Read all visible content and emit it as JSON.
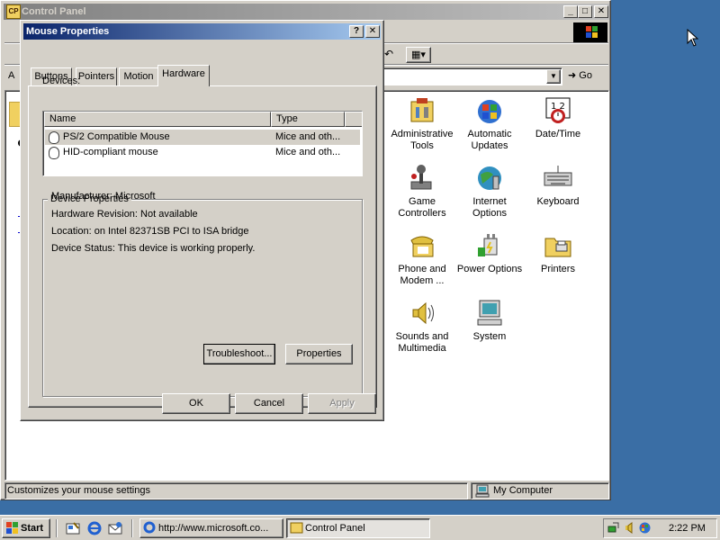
{
  "control_panel": {
    "title": "Control Panel",
    "go_label": "Go",
    "address_letter": "A",
    "status_text": "Customizes your mouse settings",
    "status_zone": "My Computer",
    "items": [
      {
        "label": "Administrative Tools",
        "icon": "admin-tools-icon"
      },
      {
        "label": "Automatic Updates",
        "icon": "windows-update-icon"
      },
      {
        "label": "Date/Time",
        "icon": "calendar-clock-icon"
      },
      {
        "label": "Game Controllers",
        "icon": "joystick-icon"
      },
      {
        "label": "Internet Options",
        "icon": "globe-icon"
      },
      {
        "label": "Keyboard",
        "icon": "keyboard-icon"
      },
      {
        "label": "Phone and Modem ...",
        "icon": "phone-icon"
      },
      {
        "label": "Power Options",
        "icon": "power-plug-icon"
      },
      {
        "label": "Printers",
        "icon": "printer-folder-icon"
      },
      {
        "label": "Sounds and Multimedia",
        "icon": "speaker-icon"
      },
      {
        "label": "System",
        "icon": "computer-icon"
      }
    ]
  },
  "dialog": {
    "title": "Mouse Properties",
    "help_glyph": "?",
    "close_glyph": "✕",
    "tabs": [
      "Buttons",
      "Pointers",
      "Motion",
      "Hardware"
    ],
    "active_tab": "Hardware",
    "devices_label": "Devices:",
    "columns": [
      "Name",
      "Type"
    ],
    "devices": [
      {
        "name": "PS/2 Compatible Mouse",
        "type": "Mice and oth..."
      },
      {
        "name": "HID-compliant mouse",
        "type": "Mice and oth..."
      }
    ],
    "group_title": "Device Properties",
    "properties": [
      "Manufacturer: Microsoft",
      "Hardware Revision: Not available",
      "Location: on Intel 82371SB PCI to ISA bridge",
      "Device Status: This device is working properly."
    ],
    "troubleshoot_label": "Troubleshoot...",
    "properties_label": "Properties",
    "ok_label": "OK",
    "cancel_label": "Cancel",
    "apply_label": "Apply"
  },
  "taskbar": {
    "start_label": "Start",
    "tasks": [
      "http://www.microsoft.co...",
      "Control Panel"
    ],
    "clock": "2:22 PM"
  },
  "colors": {
    "desktop": "#3a6ea5",
    "active_title": "#0a246a",
    "inactive_title": "#808080",
    "face": "#d4d0c8"
  }
}
